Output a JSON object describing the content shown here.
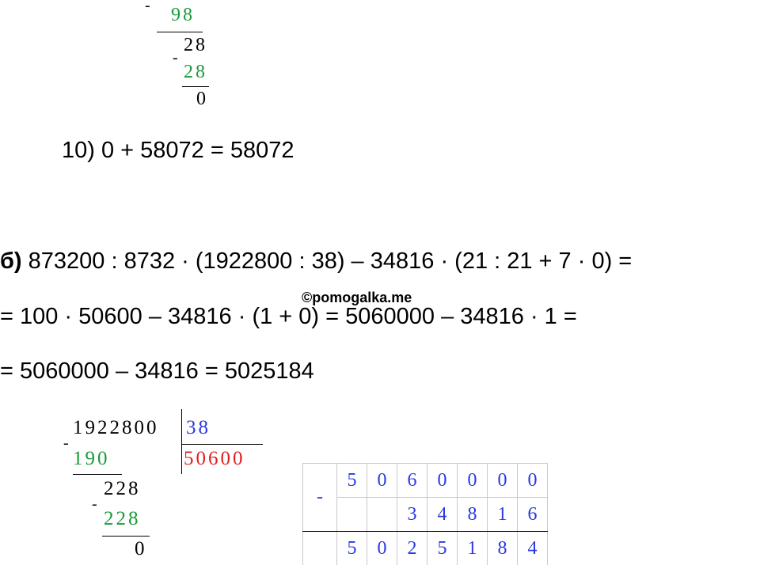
{
  "top_division": {
    "minus1": "-",
    "sub1": "98",
    "rem1": "28",
    "minus2": "-",
    "sub2": "28",
    "rem2": "0"
  },
  "step10": "10) 0 + 58072 = 58072",
  "part_b": {
    "label": "б)",
    "line1": " 873200 : 8732 · (1922800 : 38) – 34816 · (21 : 21 + 7 · 0) =",
    "line2": "= 100 · 50600 – 34816 · (1 + 0) = 5060000 – 34816 · 1 =",
    "line3": "= 5060000 – 34816 = 5025184"
  },
  "watermark": "©pomogalka.me",
  "long_division": {
    "dividend": "1922800",
    "divisor": "38",
    "quotient": "50600",
    "minus1": "-",
    "sub1": "190",
    "rem1": "228",
    "minus2": "-",
    "sub2": "228",
    "rem2": "0"
  },
  "column_subtraction": {
    "sign": "-",
    "row1": [
      "5",
      "0",
      "6",
      "0",
      "0",
      "0",
      "0"
    ],
    "row2": [
      "",
      "",
      "3",
      "4",
      "8",
      "1",
      "6"
    ],
    "row3": [
      "5",
      "0",
      "2",
      "5",
      "1",
      "8",
      "4"
    ]
  },
  "colors": {
    "green": "#1a9a3a",
    "blue": "#2a39e0",
    "red": "#e02020"
  }
}
